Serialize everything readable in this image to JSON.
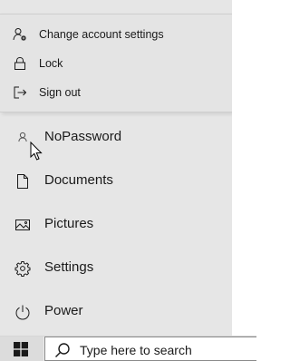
{
  "account_menu": {
    "items": [
      {
        "label": "Change account settings",
        "icon": "account-settings-icon"
      },
      {
        "label": "Lock",
        "icon": "lock-icon"
      },
      {
        "label": "Sign out",
        "icon": "sign-out-icon"
      }
    ]
  },
  "start_menu": {
    "items": [
      {
        "label": "NoPassword",
        "icon": "user-icon"
      },
      {
        "label": "Documents",
        "icon": "document-icon"
      },
      {
        "label": "Pictures",
        "icon": "pictures-icon"
      },
      {
        "label": "Settings",
        "icon": "gear-icon"
      },
      {
        "label": "Power",
        "icon": "power-icon"
      }
    ]
  },
  "taskbar": {
    "start_button_icon": "windows-logo-icon",
    "search_placeholder": "Type here to search",
    "search_icon": "search-icon"
  }
}
